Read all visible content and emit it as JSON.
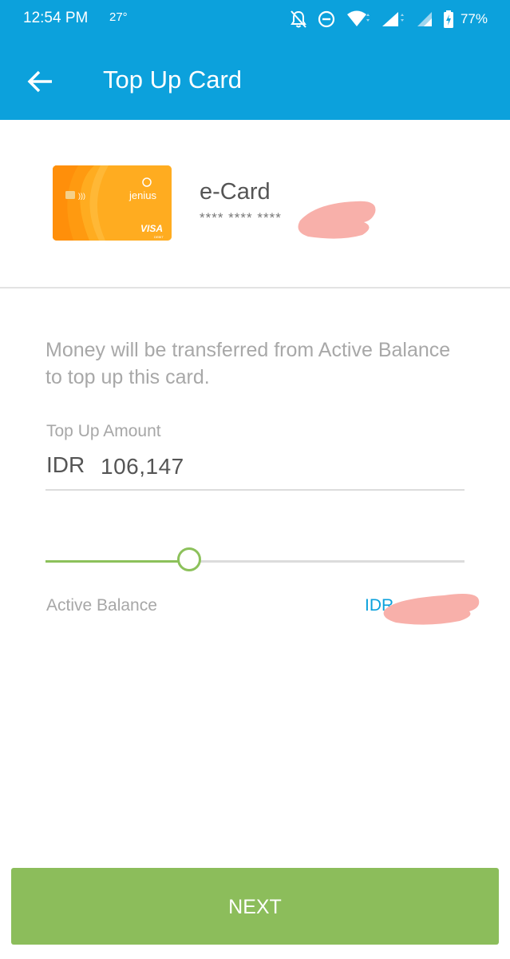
{
  "status_bar": {
    "time": "12:54 PM",
    "temperature": "27°",
    "battery": "77%",
    "icons": [
      "notifications-off-icon",
      "do-not-disturb-icon",
      "wifi-icon",
      "signal-icon",
      "signal-icon-2",
      "battery-charging-icon"
    ]
  },
  "app_bar": {
    "title": "Top Up Card",
    "back_icon": "arrow-left-icon"
  },
  "card": {
    "name": "e-Card",
    "number_masked": "**** **** ****",
    "brand": "jenius",
    "network": "VISA",
    "network_sub": "DEBIT",
    "color": "#ffac20"
  },
  "info_text": "Money will be transferred from Active Balance to top up this card.",
  "amount": {
    "label": "Top Up Amount",
    "currency": "IDR",
    "value": "106,147"
  },
  "slider": {
    "fraction": 0.342
  },
  "balance": {
    "label": "Active Balance",
    "value": "IDR"
  },
  "next_button": {
    "label": "NEXT"
  },
  "colors": {
    "primary": "#0ca1dc",
    "accent_green": "#8cbd5b",
    "redaction": "#f8b0aa"
  }
}
